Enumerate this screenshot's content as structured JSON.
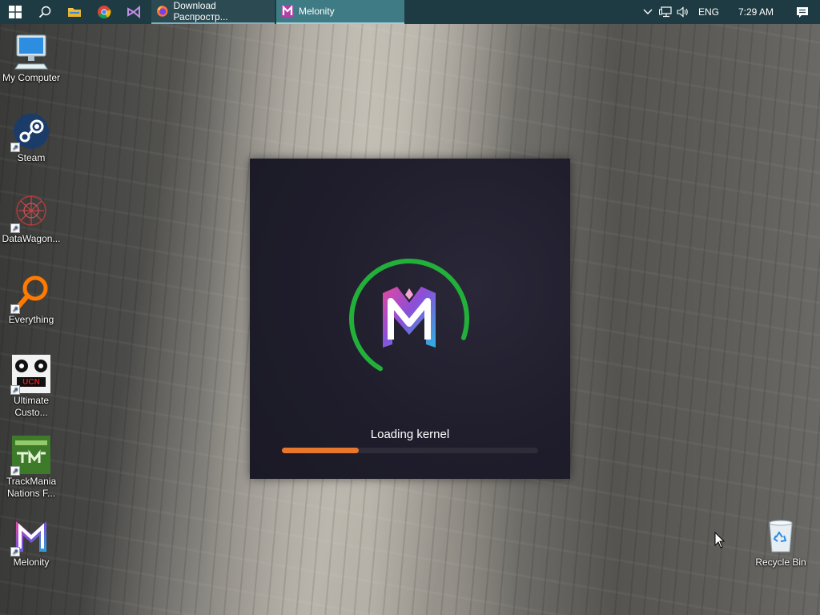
{
  "taskbar": {
    "tasks": [
      {
        "label": "Download Распростр...",
        "icon": "firefox-icon"
      },
      {
        "label": "Melonity",
        "icon": "melonity-icon"
      }
    ],
    "tray": {
      "language": "ENG",
      "time": "7:29 AM"
    }
  },
  "desktop": {
    "icons": [
      {
        "label": "My Computer",
        "icon": "computer-icon"
      },
      {
        "label": "Steam",
        "icon": "steam-icon"
      },
      {
        "label": "DataWagon...",
        "icon": "datawagon-icon"
      },
      {
        "label": "Everything",
        "icon": "everything-search-icon"
      },
      {
        "label": "Ultimate Custo...",
        "icon": "ucn-icon"
      },
      {
        "label": "TrackMania Nations F...",
        "icon": "trackmania-icon"
      },
      {
        "label": "Melonity",
        "icon": "melonity-icon"
      },
      {
        "label": "Recycle Bin",
        "icon": "recycle-bin-icon"
      }
    ]
  },
  "loader": {
    "status": "Loading kernel",
    "progress": 0.3,
    "spinner_color": "#22b03a",
    "progress_color": "#e8772e"
  }
}
